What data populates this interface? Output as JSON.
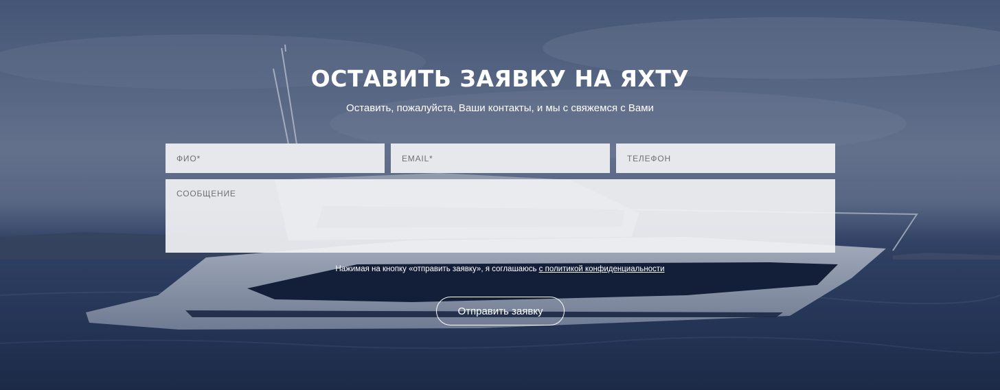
{
  "form": {
    "title": "ОСТАВИТЬ ЗАЯВКУ НА ЯХТУ",
    "subtitle": "Оставить, пожалуйста, Ваши контакты, и мы с свяжемся с Вами",
    "fields": {
      "fio_placeholder": "ФИО*",
      "email_placeholder": "EMAIL*",
      "phone_placeholder": "ТЕЛЕФОН",
      "message_placeholder": "СООБЩЕНИЕ"
    },
    "consent_text": "Нажимая на кнопку «отправить заявку», я соглашаюсь ",
    "consent_link": "с политикой конфиденциальности",
    "submit_label": "Отправить заявку"
  }
}
